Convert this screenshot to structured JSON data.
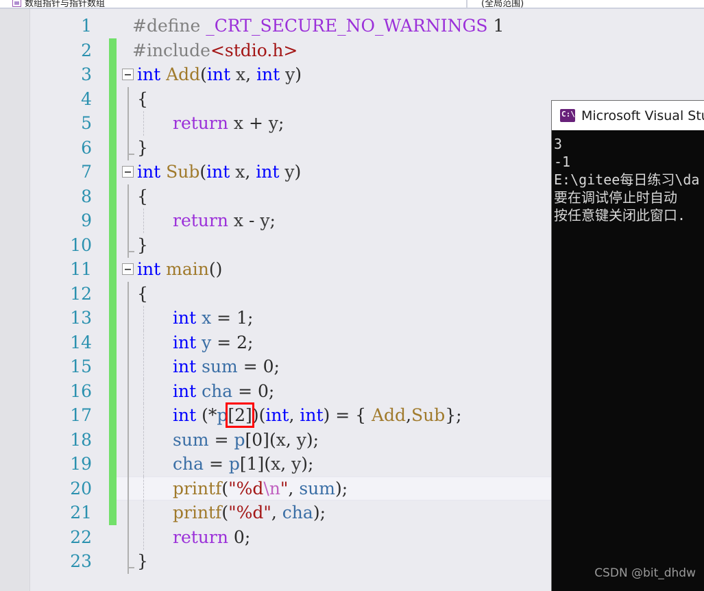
{
  "window": {
    "app": "Microsoft Visual Studio",
    "title_cut_left": "数组指针与指针数组",
    "title_cut_right": "(全局范围)"
  },
  "editor": {
    "language": "C",
    "current_line": 20,
    "highlight": {
      "line": 17,
      "text": "[2]",
      "color": "#ff0000",
      "shape": "rectangle"
    },
    "change_bar_color": "#72e06a",
    "line_number_color": "#2b91af",
    "background": "#ebebf0",
    "lines": [
      {
        "n": "1",
        "changed": false,
        "fold": false,
        "guide": "none",
        "dotted": false,
        "current": false
      },
      {
        "n": "2",
        "changed": true,
        "fold": false,
        "guide": "none",
        "dotted": false,
        "current": false
      },
      {
        "n": "3",
        "changed": true,
        "fold": true,
        "guide": "none",
        "dotted": false,
        "current": false
      },
      {
        "n": "4",
        "changed": true,
        "fold": false,
        "guide": "line",
        "dotted": false,
        "current": false
      },
      {
        "n": "5",
        "changed": true,
        "fold": false,
        "guide": "line",
        "dotted": true,
        "current": false
      },
      {
        "n": "6",
        "changed": true,
        "fold": false,
        "guide": "elbow",
        "dotted": false,
        "current": false
      },
      {
        "n": "7",
        "changed": true,
        "fold": true,
        "guide": "none",
        "dotted": false,
        "current": false
      },
      {
        "n": "8",
        "changed": true,
        "fold": false,
        "guide": "line",
        "dotted": false,
        "current": false
      },
      {
        "n": "9",
        "changed": true,
        "fold": false,
        "guide": "line",
        "dotted": true,
        "current": false
      },
      {
        "n": "10",
        "changed": true,
        "fold": false,
        "guide": "elbow",
        "dotted": false,
        "current": false
      },
      {
        "n": "11",
        "changed": true,
        "fold": true,
        "guide": "none",
        "dotted": false,
        "current": false
      },
      {
        "n": "12",
        "changed": true,
        "fold": false,
        "guide": "line",
        "dotted": false,
        "current": false
      },
      {
        "n": "13",
        "changed": true,
        "fold": false,
        "guide": "line",
        "dotted": true,
        "current": false
      },
      {
        "n": "14",
        "changed": true,
        "fold": false,
        "guide": "line",
        "dotted": true,
        "current": false
      },
      {
        "n": "15",
        "changed": true,
        "fold": false,
        "guide": "line",
        "dotted": true,
        "current": false
      },
      {
        "n": "16",
        "changed": true,
        "fold": false,
        "guide": "line",
        "dotted": true,
        "current": false
      },
      {
        "n": "17",
        "changed": true,
        "fold": false,
        "guide": "line",
        "dotted": true,
        "current": false
      },
      {
        "n": "18",
        "changed": true,
        "fold": false,
        "guide": "line",
        "dotted": true,
        "current": false
      },
      {
        "n": "19",
        "changed": true,
        "fold": false,
        "guide": "line",
        "dotted": true,
        "current": false
      },
      {
        "n": "20",
        "changed": true,
        "fold": false,
        "guide": "line",
        "dotted": true,
        "current": true
      },
      {
        "n": "21",
        "changed": true,
        "fold": false,
        "guide": "line",
        "dotted": true,
        "current": false
      },
      {
        "n": "22",
        "changed": false,
        "fold": false,
        "guide": "line",
        "dotted": true,
        "current": false
      },
      {
        "n": "23",
        "changed": false,
        "fold": false,
        "guide": "elbow",
        "dotted": false,
        "current": false
      }
    ],
    "code": {
      "l1": "#define _CRT_SECURE_NO_WARNINGS 1",
      "l2": "#include<stdio.h>",
      "l3": "int Add(int x, int y)",
      "l4": "{",
      "l5": "return x + y;",
      "l6": "}",
      "l7": "int Sub(int x, int y)",
      "l8": "{",
      "l9": "return x - y;",
      "l10": "}",
      "l11": "int main()",
      "l12": "{",
      "l13": "int x = 1;",
      "l14": "int y = 2;",
      "l15": "int sum = 0;",
      "l16": "int cha = 0;",
      "l17": "int (*p[2])(int, int) = { Add,Sub};",
      "l18": "sum = p[0](x, y);",
      "l19": "cha = p[1](x, y);",
      "l20": "printf(\"%d\\n\", sum);",
      "l21": "printf(\"%d\", cha);",
      "l22": "return 0;",
      "l23": "}"
    },
    "tokens": {
      "define": "#define",
      "macroname": "_CRT_SECURE_NO_WARNINGS",
      "one": "1",
      "include": "#include",
      "header": "<stdio.h>",
      "int": "int",
      "add": "Add",
      "sub": "Sub",
      "main": "main",
      "printf": "printf",
      "return": "return",
      "x": "x",
      "y": "y",
      "p": "p",
      "sum": "sum",
      "cha": "cha",
      "zero": "0",
      "two": "2",
      "fmt_n": "\"%d",
      "esc_n": "\\n",
      "quote": "\"",
      "fmt": "\"%d\"",
      "bracket2": "[2]",
      "bracket0": "[0]",
      "bracket1": "[1]"
    }
  },
  "console": {
    "title": "Microsoft Visual Studi",
    "icon": "cmd-prompt-icon",
    "lines": [
      "3",
      "-1",
      "E:\\gitee每日练习\\da",
      "要在调试停止时自动",
      "按任意键关闭此窗口."
    ],
    "watermark": "CSDN @bit_dhdw"
  }
}
